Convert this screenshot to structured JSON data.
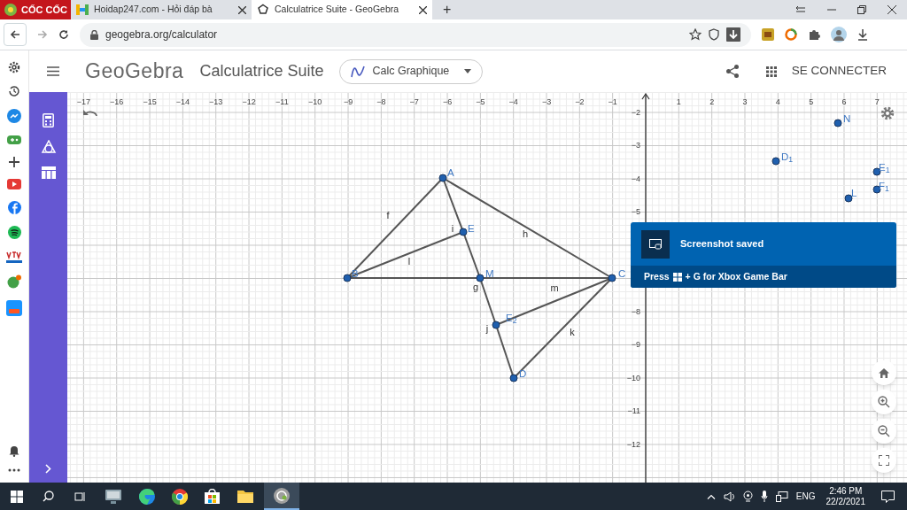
{
  "browser": {
    "brand": "CỐC CỐC",
    "tabs": [
      {
        "title": "Hoidap247.com - Hỏi đáp bà",
        "selected": false
      },
      {
        "title": "Calculatrice Suite - GeoGebra",
        "selected": true
      }
    ],
    "new_tab": "+",
    "url": "geogebra.org/calculator"
  },
  "app": {
    "logo": "GeoGebra",
    "title": "Calculatrice Suite",
    "mode": "Calc Graphique",
    "sign_in": "SE CONNECTER"
  },
  "graph": {
    "x_ticks": [
      "−17",
      "−16",
      "−15",
      "−14",
      "−13",
      "−12",
      "−11",
      "−10",
      "−9",
      "−8",
      "−7",
      "−6",
      "−5",
      "−4",
      "−3",
      "−2",
      "−1",
      "1",
      "2",
      "3",
      "4",
      "5",
      "6",
      "7"
    ],
    "y_ticks": [
      "−2",
      "−3",
      "−4",
      "−5",
      "−8",
      "−9",
      "−10",
      "−11",
      "−12"
    ],
    "points": [
      {
        "label": "N"
      },
      {
        "label": "D$_{1}$"
      },
      {
        "label": "E$_{1}$"
      },
      {
        "label": "A"
      },
      {
        "label": "F$_{1}$"
      },
      {
        "label": "L"
      },
      {
        "label": "E"
      },
      {
        "label": "B"
      },
      {
        "label": "M"
      },
      {
        "label": "C"
      },
      {
        "label": "E$_{2}$"
      },
      {
        "label": "D"
      }
    ],
    "segments": [
      {
        "label": "f"
      },
      {
        "label": "h"
      },
      {
        "label": "i"
      },
      {
        "label": "l"
      },
      {
        "label": "g"
      },
      {
        "label": "m"
      },
      {
        "label": "j"
      },
      {
        "label": "k"
      }
    ]
  },
  "toast": {
    "title": "Screenshot saved",
    "hint_before": "Press",
    "hint_after": "+ G for Xbox Game Bar"
  },
  "taskbar": {
    "language": "ENG",
    "time": "2:46 PM",
    "date": "22/2/2021"
  }
}
